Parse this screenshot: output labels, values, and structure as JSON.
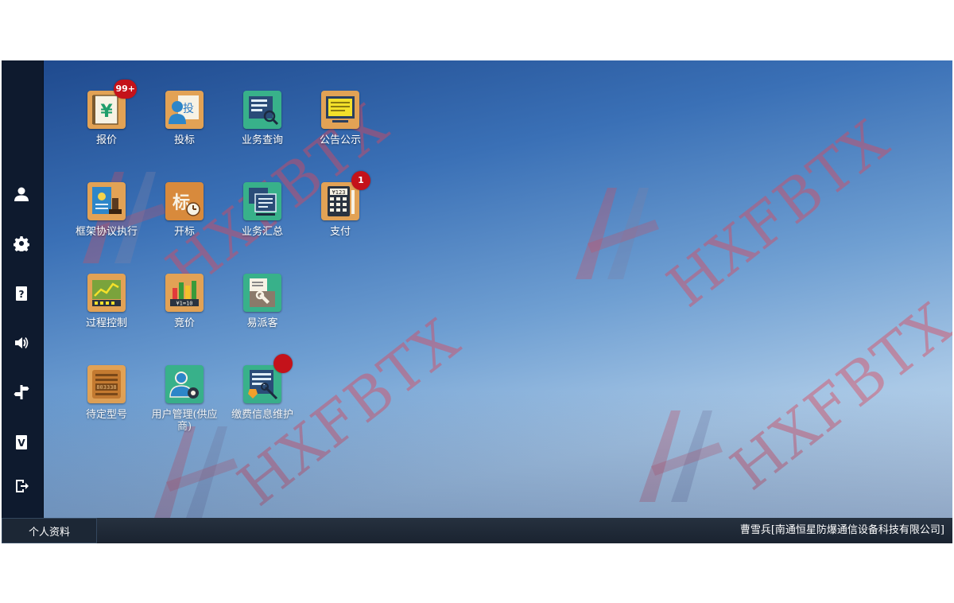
{
  "watermark_text": "HXFBTX",
  "apps": [
    {
      "id": "baojia",
      "label": "报价",
      "badge": "99+",
      "color": "#e2a255",
      "icon": "ledger-yen-icon"
    },
    {
      "id": "toubiao",
      "label": "投标",
      "badge": "",
      "color": "#e2a255",
      "icon": "bid-user-icon"
    },
    {
      "id": "yewu-chaxun",
      "label": "业务查询",
      "badge": "",
      "color": "#38b18a",
      "icon": "search-report-icon"
    },
    {
      "id": "gonggao",
      "label": "公告公示",
      "badge": "",
      "color": "#e2a255",
      "icon": "notice-board-icon"
    },
    {
      "id": "kuangjia",
      "label": "框架协议执行",
      "badge": "",
      "color": "#e2a255",
      "icon": "agreement-stamp-icon"
    },
    {
      "id": "kaibiao",
      "label": "开标",
      "badge": "",
      "color": "#d88a3c",
      "icon": "open-bid-clock-icon"
    },
    {
      "id": "yewu-huizong",
      "label": "业务汇总",
      "badge": "",
      "color": "#38b18a",
      "icon": "summary-docs-icon"
    },
    {
      "id": "zhifu",
      "label": "支付",
      "badge": "1",
      "color": "#e2a255",
      "icon": "calculator-icon"
    },
    {
      "id": "guocheng",
      "label": "过程控制",
      "badge": "",
      "color": "#e2a255",
      "icon": "process-chart-icon"
    },
    {
      "id": "jingjia",
      "label": "竞价",
      "badge": "",
      "color": "#e2a255",
      "icon": "auction-bars-icon"
    },
    {
      "id": "yipaike",
      "label": "易派客",
      "badge": "",
      "color": "#38b18a",
      "icon": "document-tool-icon"
    },
    {
      "id": "daiding",
      "label": "待定型号",
      "badge": "",
      "color": "#e2a255",
      "icon": "pending-model-icon"
    },
    {
      "id": "yonghu",
      "label": "用户管理(供应商)",
      "badge": "",
      "color": "#38b18a",
      "icon": "user-settings-icon"
    },
    {
      "id": "jiaofei",
      "label": "缴费信息维护",
      "badge": " ",
      "color": "#38b18a",
      "icon": "payment-edit-icon"
    }
  ],
  "sidebar": [
    {
      "name": "user-icon"
    },
    {
      "name": "gear-icon"
    },
    {
      "name": "help-book-icon"
    },
    {
      "name": "speaker-icon"
    },
    {
      "name": "signpost-icon"
    },
    {
      "name": "check-doc-icon"
    },
    {
      "name": "logout-icon"
    }
  ],
  "taskbar": {
    "start_label": "个人资料",
    "user_label": "曹雪兵[南通恒星防爆通信设备科技有限公司]"
  },
  "colors": {
    "badge": "#c4121a",
    "sidebar": "#0e1a2e",
    "taskbar": "#1a2330"
  }
}
